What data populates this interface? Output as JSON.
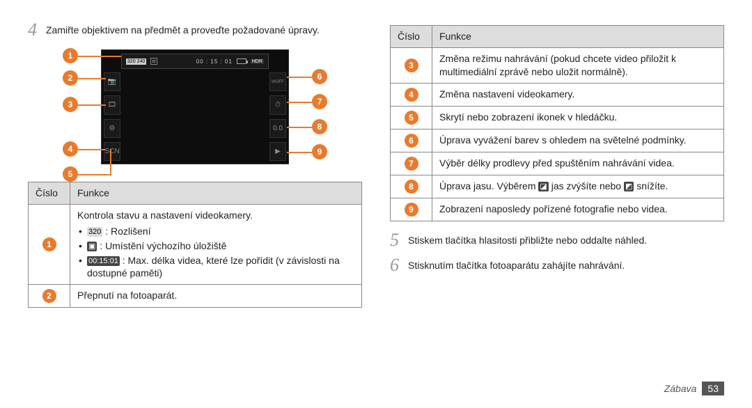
{
  "footer": {
    "section": "Zábava",
    "page": "53"
  },
  "left": {
    "step4_num": "4",
    "step4_text": "Zamiřte objektivem na předmět a proveďte požadované úpravy.",
    "topbar": {
      "res": "320 240",
      "time": "00 : 15 : 01",
      "hdr": "HDR"
    },
    "sideR": {
      "woff": "WOFF",
      "zero": "0.0",
      "play": "▶"
    },
    "callouts": {
      "c1": "1",
      "c2": "2",
      "c3": "3",
      "c4": "4",
      "c5": "5",
      "c6": "6",
      "c7": "7",
      "c8": "8",
      "c9": "9"
    },
    "table": {
      "h1": "Číslo",
      "h2": "Funkce",
      "r1_intro": "Kontrola stavu a nastavení videokamery.",
      "r1_b1": ": Rozlišení",
      "r1_b2": ": Umístění výchozího úložiště",
      "r1_b3": ": Max. délka videa, které lze pořídit (v závislosti na dostupné paměti)",
      "r1_b3_icon": "00:15:01",
      "r2": "Přepnutí na fotoaparát."
    }
  },
  "right": {
    "table": {
      "h1": "Číslo",
      "h2": "Funkce",
      "r3": "Změna režimu nahrávání (pokud chcete video přiložit k multimediální zprávě nebo uložit normálně).",
      "r4": "Změna nastavení videokamery.",
      "r5": "Skrytí nebo zobrazení ikonek v hledáčku.",
      "r6": "Úprava vyvážení barev s ohledem na světelné podmínky.",
      "r7": "Výběr délky prodlevy před spuštěním nahrávání videa.",
      "r8_a": "Úprava jasu. Výběrem ",
      "r8_b": " jas zvýšíte nebo ",
      "r8_c": " snížíte.",
      "r9": "Zobrazení naposledy pořízené fotografie nebo videa."
    },
    "step5_num": "5",
    "step5_text": "Stiskem tlačítka hlasitosti přibližte nebo oddalte náhled.",
    "step6_num": "6",
    "step6_text": "Stisknutím tlačítka fotoaparátu zahájíte nahrávání."
  }
}
